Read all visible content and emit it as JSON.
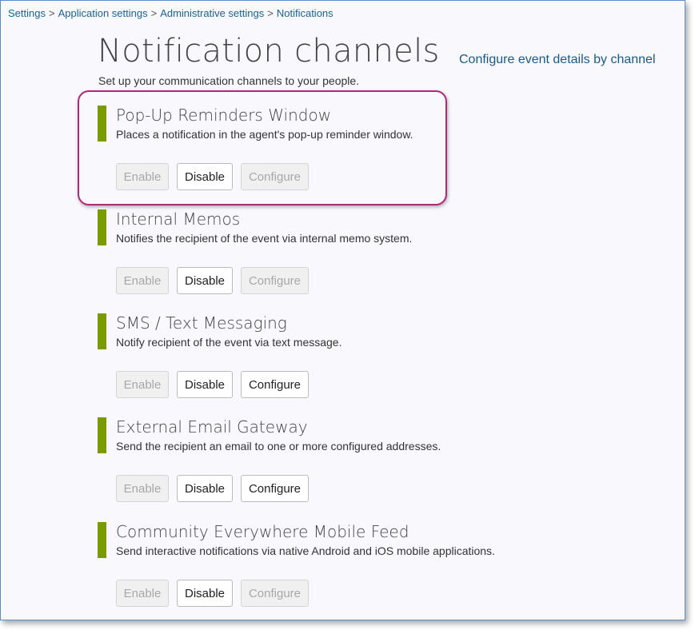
{
  "breadcrumb": {
    "items": [
      "Settings",
      "Application settings",
      "Administrative settings"
    ],
    "current": "Notifications",
    "separator": ">"
  },
  "header": {
    "title": "Notification channels",
    "subtitle": "Set up your communication channels to your people.",
    "configure_link": "Configure event details by channel"
  },
  "channels": [
    {
      "name": "Pop-Up Reminders Window",
      "description": "Places a notification in the agent's pop-up reminder window.",
      "enable_label": "Enable",
      "disable_label": "Disable",
      "configure_label": "Configure",
      "enable_enabled": false,
      "disable_enabled": true,
      "configure_enabled": false,
      "highlighted": true
    },
    {
      "name": "Internal Memos",
      "description": "Notifies the recipient of the event via internal memo system.",
      "enable_label": "Enable",
      "disable_label": "Disable",
      "configure_label": "Configure",
      "enable_enabled": false,
      "disable_enabled": true,
      "configure_enabled": false
    },
    {
      "name": "SMS / Text Messaging",
      "description": "Notify recipient of the event via text message.",
      "enable_label": "Enable",
      "disable_label": "Disable",
      "configure_label": "Configure",
      "enable_enabled": false,
      "disable_enabled": true,
      "configure_enabled": true
    },
    {
      "name": "External Email Gateway",
      "description": "Send the recipient an email to one or more configured addresses.",
      "enable_label": "Enable",
      "disable_label": "Disable",
      "configure_label": "Configure",
      "enable_enabled": false,
      "disable_enabled": true,
      "configure_enabled": true
    },
    {
      "name": "Community Everywhere Mobile Feed",
      "description": "Send interactive notifications via native Android and iOS mobile applications.",
      "enable_label": "Enable",
      "disable_label": "Disable",
      "configure_label": "Configure",
      "enable_enabled": false,
      "disable_enabled": true,
      "configure_enabled": false
    }
  ],
  "colors": {
    "accent_bar": "#7a9a01",
    "link": "#1a5a8a",
    "highlight": "#b0287a",
    "background": "#f8f8fd"
  }
}
